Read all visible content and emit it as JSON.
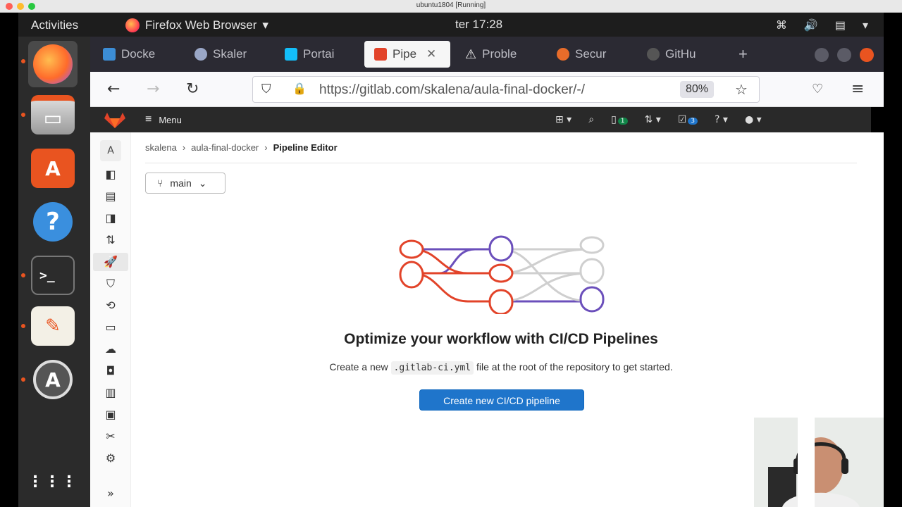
{
  "host": {
    "title": "ubuntu1804 [Running]"
  },
  "topbar": {
    "activities": "Activities",
    "app_name": "Firefox Web Browser",
    "clock": "ter 17:28"
  },
  "browser": {
    "tabs": [
      {
        "label": "Docke",
        "color": "#3c8dd6"
      },
      {
        "label": "Skaler",
        "color": "#9aa7c7"
      },
      {
        "label": "Portai",
        "color": "#13bef9"
      },
      {
        "label": "Pipe",
        "color": "#e24329",
        "active": true
      },
      {
        "label": "Proble",
        "color": "#f1f1f1"
      },
      {
        "label": "Secur",
        "color": "#e86c2a"
      },
      {
        "label": "GitHu",
        "color": "#222"
      }
    ],
    "url": "https://gitlab.com/skalena/aula-final-docker/-/",
    "zoom": "80%"
  },
  "gitlab": {
    "menu_label": "Menu",
    "badges": {
      "issues": "1",
      "todos": "3"
    },
    "project_avatar": "A",
    "breadcrumb": [
      "skalena",
      "aula-final-docker",
      "Pipeline Editor"
    ],
    "branch": "main",
    "empty_state": {
      "title": "Optimize your workflow with CI/CD Pipelines",
      "text_before": "Create a new",
      "code": ".gitlab-ci.yml",
      "text_after": "file at the root of the repository to get started.",
      "button": "Create new CI/CD pipeline"
    },
    "colors": {
      "accent": "#1f75cb",
      "orange": "#e24329",
      "purple": "#6b4fbb"
    }
  }
}
